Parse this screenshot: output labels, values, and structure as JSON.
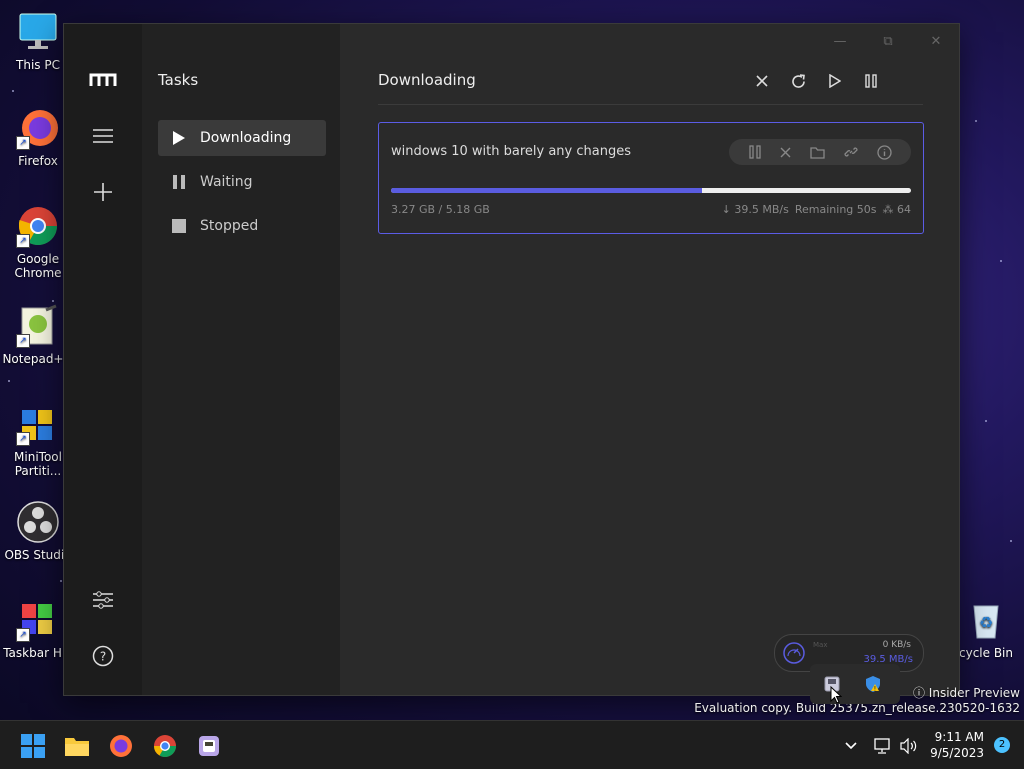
{
  "desktop": {
    "icons": [
      {
        "label": "This PC"
      },
      {
        "label": "Firefox"
      },
      {
        "label": "Google Chrome"
      },
      {
        "label": "Notepad++"
      },
      {
        "label": "MiniTool Partiti..."
      },
      {
        "label": "OBS Studio"
      },
      {
        "label": "Taskbar Hid"
      },
      {
        "label": "cycle Bin"
      }
    ],
    "watermark": {
      "line1": "ⓘ Insider Preview",
      "line2": "Evaluation copy. Build 25375.zn_release.230520-1632"
    }
  },
  "app": {
    "sidebar": {
      "title": "Tasks",
      "items": [
        {
          "label": "Downloading",
          "icon": "play-icon",
          "active": true
        },
        {
          "label": "Waiting",
          "icon": "pause-icon",
          "active": false
        },
        {
          "label": "Stopped",
          "icon": "stop-icon",
          "active": false
        }
      ]
    },
    "main": {
      "title": "Downloading",
      "toolbar": [
        "close-icon",
        "refresh-icon",
        "play-icon",
        "pause-icon"
      ],
      "task": {
        "name": "windows 10 with barely any changes",
        "progress_percent": 59.8,
        "size_text": "3.27 GB / 5.18 GB",
        "speed_text": "↓ 39.5 MB/s",
        "remaining_text": "Remaining 50s",
        "connections_text": "⁂ 64"
      }
    },
    "speed_widget": {
      "label": "Max",
      "upload": "0 KB/s",
      "download": "39.5 MB/s"
    },
    "colors": {
      "accent": "#5a5ce0"
    }
  },
  "taskbar": {
    "time": "9:11 AM",
    "date": "9/5/2023",
    "notifications": "2"
  }
}
